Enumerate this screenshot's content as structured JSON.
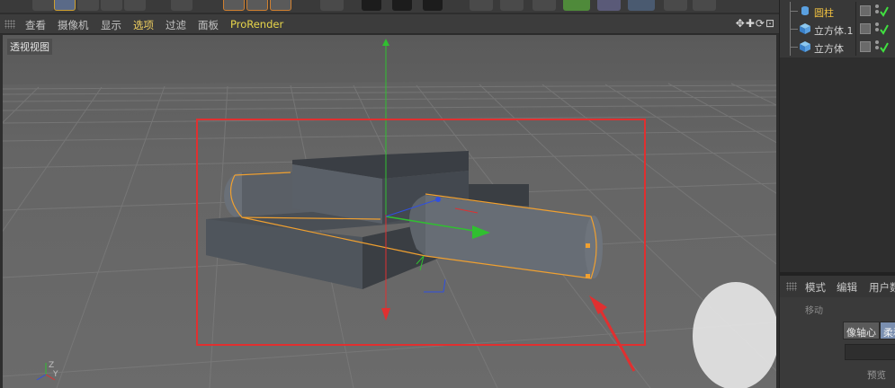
{
  "viewport_menu": {
    "items": [
      {
        "label": "查看",
        "active": false
      },
      {
        "label": "摄像机",
        "active": false
      },
      {
        "label": "显示",
        "active": false
      },
      {
        "label": "选项",
        "active": true
      },
      {
        "label": "过滤",
        "active": false
      },
      {
        "label": "面板",
        "active": false
      },
      {
        "label": "ProRender",
        "active": false
      }
    ],
    "nav_icons": "✥✚⟳⊡"
  },
  "viewport": {
    "label": "透视视图",
    "axis_labels": {
      "y": "Y",
      "z": "Z"
    }
  },
  "objects": [
    {
      "name": "圆柱",
      "icon": "cylinder-icon",
      "selected": true
    },
    {
      "name": "立方体.1",
      "icon": "cube-icon",
      "selected": false
    },
    {
      "name": "立方体",
      "icon": "cube-icon",
      "selected": false
    }
  ],
  "attributes": {
    "menu": [
      "模式",
      "编辑",
      "用户数"
    ],
    "dim_text": "移动",
    "tabs": [
      "像轴心",
      "柔和"
    ],
    "preview_label": "预览"
  },
  "colors": {
    "selection": "#f0a030",
    "annotation_red": "#e03030",
    "axis_y": "#30c030",
    "axis_x": "#e03030",
    "axis_z": "#3050e0",
    "check": "#40e040"
  }
}
